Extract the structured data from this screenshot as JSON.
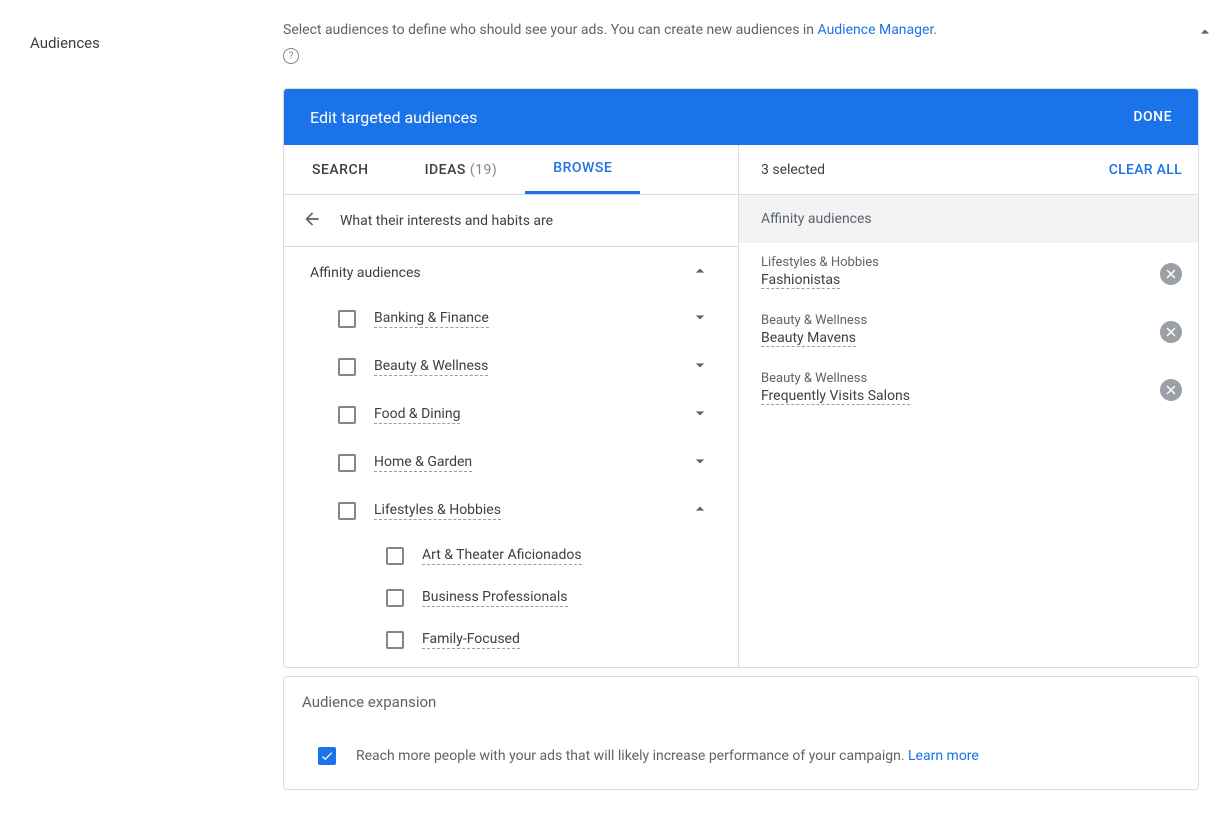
{
  "section_label": "Audiences",
  "intro_text_pre": "Select audiences to define who should see your ads.  You can create new audiences in ",
  "intro_link": "Audience Manager",
  "intro_text_post": ".",
  "panel_title": "Edit targeted audiences",
  "done_label": "DONE",
  "tabs": {
    "search": "SEARCH",
    "ideas": "IDEAS",
    "ideas_count": "(19)",
    "browse": "BROWSE"
  },
  "breadcrumb": "What their interests and habits are",
  "group_title": "Affinity audiences",
  "categories": [
    {
      "label": "Banking & Finance",
      "expanded": false
    },
    {
      "label": "Beauty & Wellness",
      "expanded": false
    },
    {
      "label": "Food & Dining",
      "expanded": false
    },
    {
      "label": "Home & Garden",
      "expanded": false
    },
    {
      "label": "Lifestyles & Hobbies",
      "expanded": true
    }
  ],
  "subitems": [
    "Art & Theater Aficionados",
    "Business Professionals",
    "Family-Focused"
  ],
  "selected_header": "3 selected",
  "clear_all": "CLEAR ALL",
  "selected_group_label": "Affinity audiences",
  "selected": [
    {
      "category": "Lifestyles & Hobbies",
      "name": "Fashionistas"
    },
    {
      "category": "Beauty & Wellness",
      "name": "Beauty Mavens"
    },
    {
      "category": "Beauty & Wellness",
      "name": "Frequently Visits Salons"
    }
  ],
  "expansion": {
    "title": "Audience expansion",
    "text": "Reach more people with your ads that will likely increase performance of your campaign. ",
    "link": "Learn more"
  }
}
